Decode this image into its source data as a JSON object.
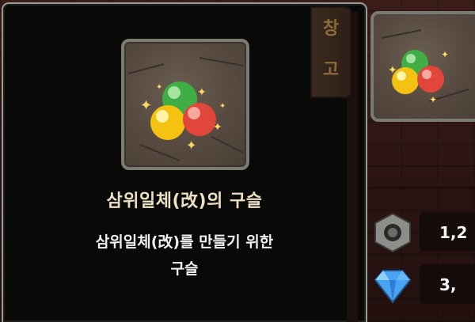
{
  "storage_tab": {
    "chars": [
      "창",
      "고"
    ]
  },
  "item": {
    "name": "삼위일체(改)의 구슬",
    "description": "삼위일체(改)를 만들기 위한\n구슬",
    "icon": "trinity-orb-icon"
  },
  "currencies": [
    {
      "icon": "bolt-nut-icon",
      "value": "1,2"
    },
    {
      "icon": "diamond-gem-icon",
      "value": "3,"
    }
  ],
  "colors": {
    "orb_green": "#3fae45",
    "orb_yellow": "#f5c211",
    "orb_red": "#e0463a",
    "tooltip_border": "#9b9b98",
    "name_text": "#ede1c3"
  }
}
